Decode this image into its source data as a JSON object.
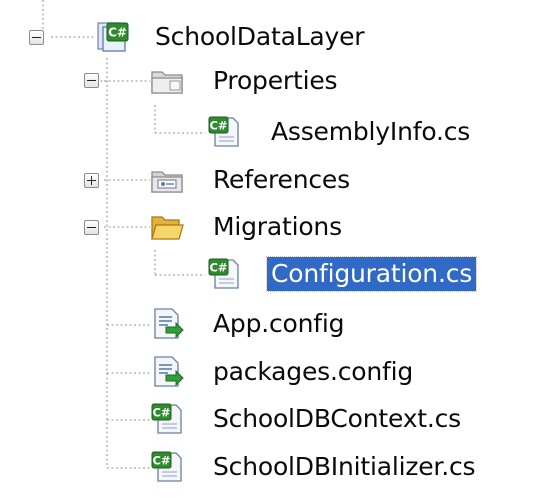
{
  "tree": {
    "root": {
      "label": "SchoolDataLayer",
      "icon": "csharp-project-icon",
      "expanded": true
    },
    "items": [
      {
        "label": "Properties",
        "icon": "folder-properties-icon",
        "expanded": true
      },
      {
        "label": "AssemblyInfo.cs",
        "icon": "csharp-file-icon"
      },
      {
        "label": "References",
        "icon": "references-icon",
        "expanded": false
      },
      {
        "label": "Migrations",
        "icon": "folder-open-icon",
        "expanded": true
      },
      {
        "label": "Configuration.cs",
        "icon": "csharp-file-icon",
        "selected": true
      },
      {
        "label": "App.config",
        "icon": "config-file-icon"
      },
      {
        "label": "packages.config",
        "icon": "config-file-icon"
      },
      {
        "label": "SchoolDBContext.cs",
        "icon": "csharp-file-icon"
      },
      {
        "label": "SchoolDBInitializer.cs",
        "icon": "csharp-file-icon"
      }
    ]
  },
  "colors": {
    "selection": "#3169c6",
    "tree_lines": "#a8a8a8"
  }
}
